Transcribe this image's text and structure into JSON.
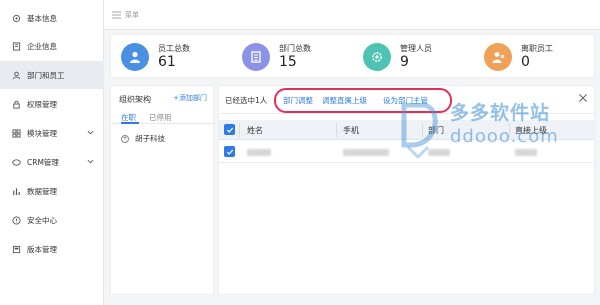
{
  "sidebar": {
    "items": [
      {
        "label": "基本信息",
        "icon": "settings-icon"
      },
      {
        "label": "企业信息",
        "icon": "building-icon"
      },
      {
        "label": "部门和员工",
        "icon": "user-icon",
        "active": true
      },
      {
        "label": "权限管理",
        "icon": "lock-icon"
      },
      {
        "label": "模块管理",
        "icon": "grid-icon"
      },
      {
        "label": "CRM管理",
        "icon": "crm-icon"
      },
      {
        "label": "数据管理",
        "icon": "bar-chart-icon"
      },
      {
        "label": "安全中心",
        "icon": "shield-icon"
      },
      {
        "label": "版本管理",
        "icon": "version-icon"
      }
    ]
  },
  "topbar": {
    "menu_label": "菜单"
  },
  "stats": [
    {
      "label": "员工总数",
      "value": "61",
      "color": "#4a90e2",
      "icon": "person-icon"
    },
    {
      "label": "部门总数",
      "value": "15",
      "color": "#8c93e6",
      "icon": "building-icon"
    },
    {
      "label": "管理人员",
      "value": "9",
      "color": "#4ec2b3",
      "icon": "gear-icon"
    },
    {
      "label": "离职员工",
      "value": "0",
      "color": "#f0a157",
      "icon": "person-leave-icon"
    }
  ],
  "org": {
    "title": "组织架构",
    "add_label": "+添加部门",
    "tabs": [
      "在职",
      "已停用"
    ],
    "tree": [
      {
        "label": "胡子科技"
      }
    ]
  },
  "main": {
    "selected_text": "已经选中1人",
    "actions": [
      "部门调整",
      "调整直属上级",
      "设为部门主管"
    ],
    "columns": [
      "姓名",
      "手机",
      "部门",
      "直接上级"
    ]
  },
  "watermark": {
    "text": "多多软件站",
    "url": "ddooo.com"
  },
  "colors": {
    "accent": "#2f7be5",
    "highlight": "#e0305a"
  }
}
